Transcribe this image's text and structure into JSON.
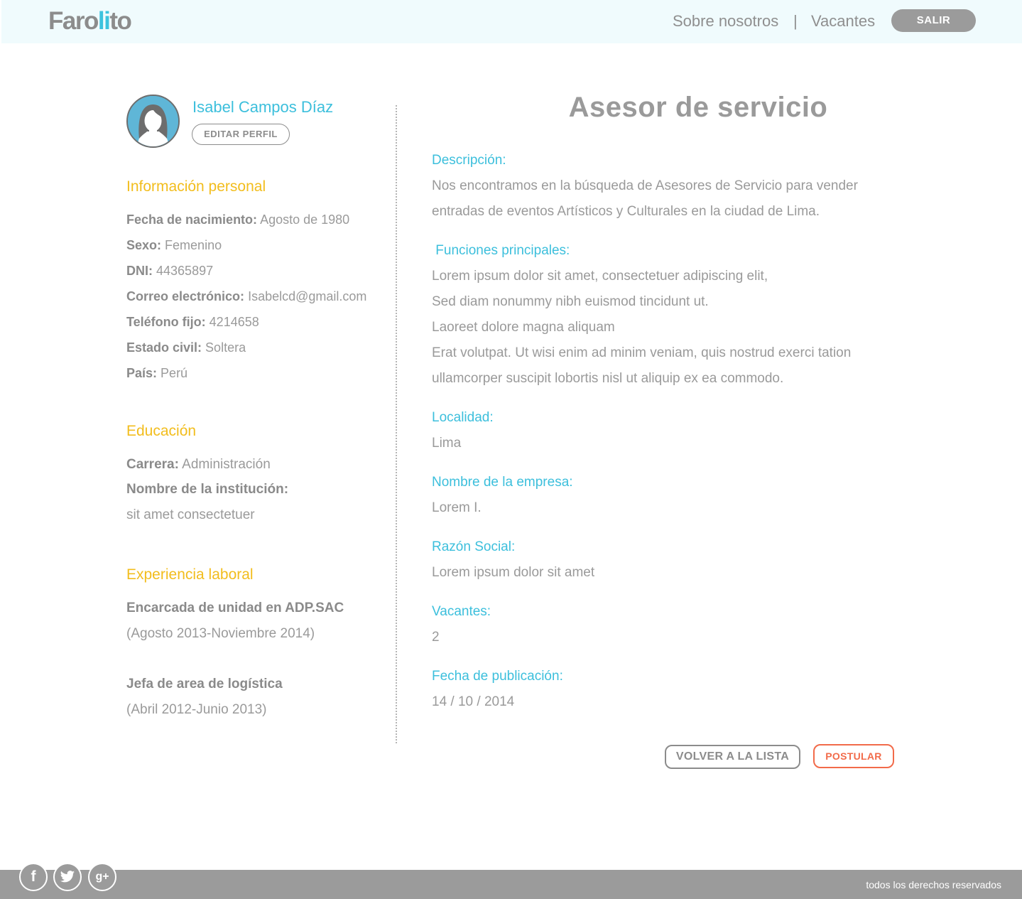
{
  "header": {
    "logo_text_1": "Faro",
    "logo_text_2": "li",
    "logo_text_3": "to",
    "nav_about": "Sobre nosotros",
    "nav_separator": "|",
    "nav_vacancies": "Vacantes",
    "logout_label": "SALIR"
  },
  "profile": {
    "name": "Isabel Campos Díaz",
    "edit_label": "EDITAR PERFIL",
    "avatar_icon": "user-female-icon"
  },
  "personal": {
    "title": "Información personal",
    "fields": [
      {
        "label": "Fecha de nacimiento:",
        "value": "Agosto de 1980"
      },
      {
        "label": "Sexo:",
        "value": "Femenino"
      },
      {
        "label": "DNI:",
        "value": "44365897"
      },
      {
        "label": "Correo electrónico:",
        "value": "Isabelcd@gmail.com"
      },
      {
        "label": "Teléfono fijo:",
        "value": "4214658"
      },
      {
        "label": "Estado civil:",
        "value": "Soltera"
      },
      {
        "label": "País:",
        "value": "Perú"
      }
    ]
  },
  "education": {
    "title": "Educación",
    "career_label": "Carrera:",
    "career_value": "Administración",
    "institution_label": "Nombre de la institución:",
    "institution_value": "sit amet consectetuer"
  },
  "experience": {
    "title": "Experiencia laboral",
    "items": [
      {
        "role": "Encarcada de unidad en ADP.SAC",
        "period": "(Agosto 2013-Noviembre 2014)"
      },
      {
        "role": "Jefa de area de logística",
        "period": "(Abril 2012-Junio 2013)"
      }
    ]
  },
  "job": {
    "title": "Asesor de servicio",
    "description_label": "Descripción:",
    "description_lines": [
      "Nos encontramos en la búsqueda de Asesores de Servicio para vender",
      "entradas de eventos Artísticos y Culturales en la ciudad de Lima."
    ],
    "functions_label": " Funciones principales:",
    "functions_lines": [
      "Lorem ipsum dolor sit amet, consectetuer adipiscing elit,",
      "Sed diam nonummy nibh euismod tincidunt ut.",
      "Laoreet dolore magna aliquam",
      "Erat volutpat. Ut wisi enim ad minim veniam, quis nostrud exerci tation",
      "ullamcorper suscipit lobortis nisl ut aliquip ex ea commodo."
    ],
    "location_label": "Localidad:",
    "location_value": "Lima",
    "company_label": "Nombre de la empresa:",
    "company_value": "Lorem I.",
    "business_label": "Razón Social:",
    "business_value": "Lorem ipsum dolor sit amet",
    "vacancies_label": "Vacantes:",
    "vacancies_value": "2",
    "date_label": "Fecha de publicación:",
    "date_value": "14 / 10 / 2014",
    "back_label": "VOLVER A LA LISTA",
    "apply_label": "POSTULAR"
  },
  "footer": {
    "facebook_glyph": "f",
    "googleplus_glyph": "g+",
    "copyright": "todos los derechos reservados"
  },
  "colors": {
    "accent_blue": "#3cbfdc",
    "section_yellow": "#f2bd1d",
    "apply_orange": "#f26b4a",
    "header_bg": "#f0fbfd",
    "footer_bg": "#9b9b9b"
  }
}
